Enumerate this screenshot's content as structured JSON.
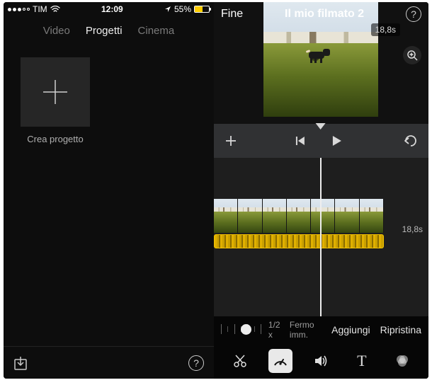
{
  "status": {
    "carrier": "TIM",
    "time": "12:09",
    "battery_pct": "55%"
  },
  "tabs": {
    "video": "Video",
    "progetti": "Progetti",
    "cinema": "Cinema"
  },
  "project": {
    "create_label": "Crea progetto"
  },
  "editor": {
    "done": "Fine",
    "title": "Il mio filmato 2",
    "duration": "18,8s",
    "timeline_duration": "18,8s"
  },
  "speed": {
    "ratio": "1/2",
    "x": "x",
    "freeze": "Fermo imm.",
    "add": "Aggiungi",
    "reset": "Ripristina"
  },
  "tools": {
    "cut": "scissors-icon",
    "speed": "speedometer-icon",
    "volume": "volume-icon",
    "text": "T",
    "filter": "filters-icon"
  }
}
